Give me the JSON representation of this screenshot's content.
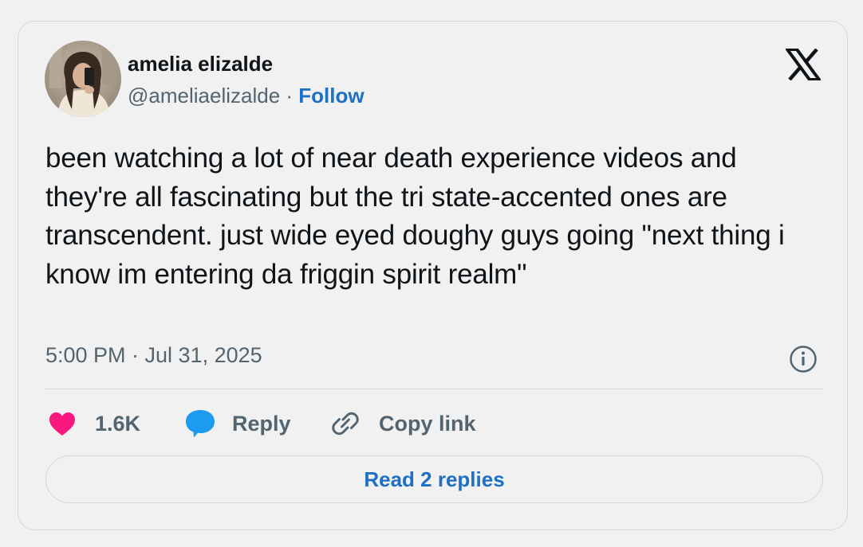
{
  "author": {
    "name": "amelia elizalde",
    "handle": "@ameliaelizalde",
    "separator": "·",
    "follow_label": "Follow"
  },
  "tweet": {
    "text": "been watching a lot of near death experience videos and they're all fascinating but the tri state-accented ones are transcendent. just wide eyed doughy guys going \"next thing i know im entering da friggin spirit realm\"",
    "timestamp": "5:00 PM · Jul 31, 2025"
  },
  "actions": {
    "like_count": "1.6K",
    "reply_label": "Reply",
    "copy_link_label": "Copy link"
  },
  "read_replies_label": "Read 2 replies",
  "icons": {
    "logo": "x-logo-icon",
    "info": "info-icon",
    "like": "heart-icon",
    "reply": "speech-bubble-icon",
    "copy": "link-icon"
  },
  "colors": {
    "link": "#1d70c4",
    "heart": "#f91880",
    "reply_bubble": "#1d9bf0",
    "muted_text": "#536471",
    "border": "#cfd9de"
  }
}
